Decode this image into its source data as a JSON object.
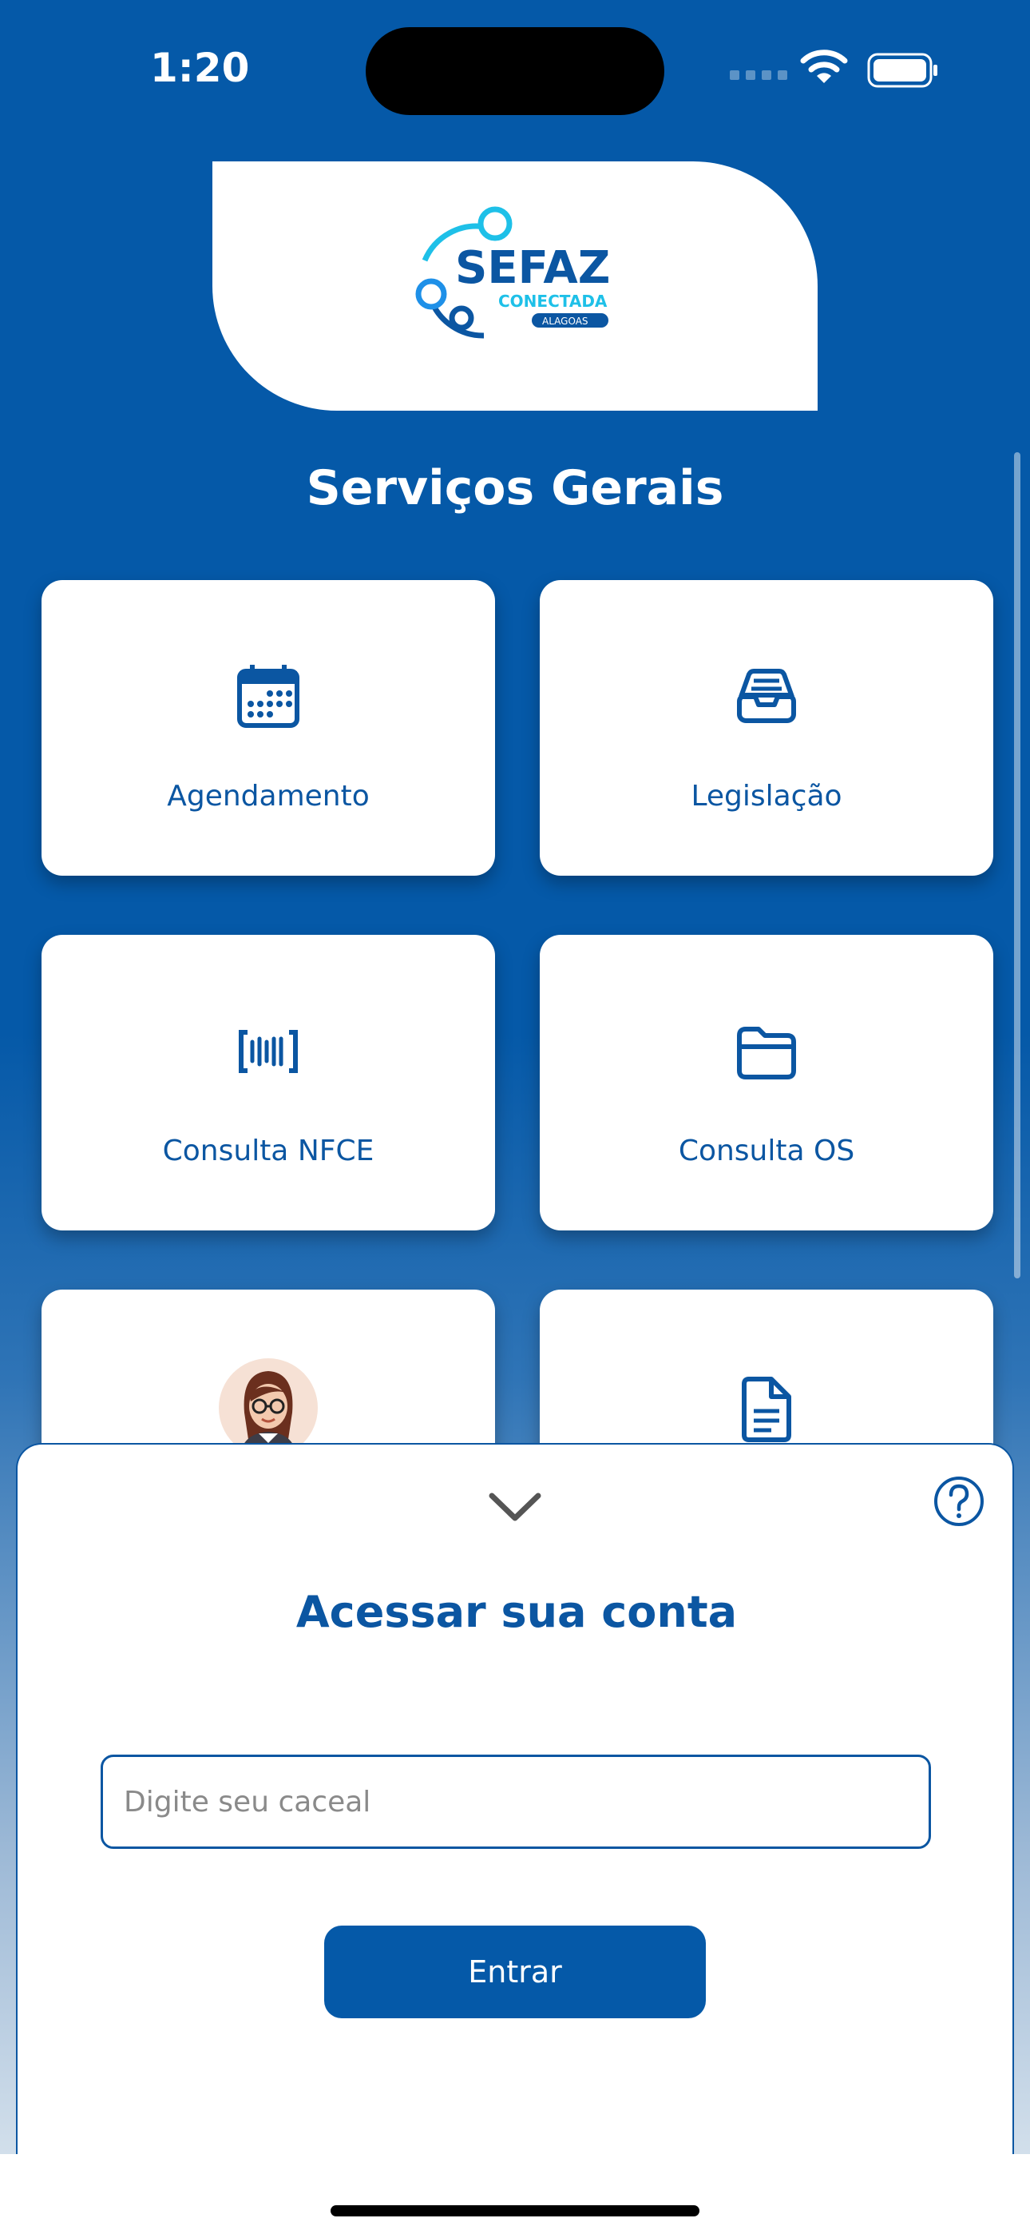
{
  "status_bar": {
    "time": "1:20"
  },
  "logo": {
    "main": "SEFAZ",
    "sub": "CONECTADA",
    "state": "ALAGOAS"
  },
  "page": {
    "title": "Serviços Gerais"
  },
  "services": [
    {
      "label": "Agendamento",
      "icon": "calendar-icon"
    },
    {
      "label": "Legislação",
      "icon": "inbox-tray-icon"
    },
    {
      "label": "Consulta NFCE",
      "icon": "barcode-icon"
    },
    {
      "label": "Consulta OS",
      "icon": "folder-icon"
    },
    {
      "label": "",
      "icon": "assistant-avatar"
    },
    {
      "label": "",
      "icon": "document-icon"
    }
  ],
  "login_sheet": {
    "title": "Acessar sua conta",
    "caceal_placeholder": "Digite seu caceal",
    "caceal_value": "",
    "submit_label": "Entrar"
  },
  "colors": {
    "primary": "#0559a8",
    "accent": "#1ec0e8",
    "text_blue": "#0b56a2"
  }
}
